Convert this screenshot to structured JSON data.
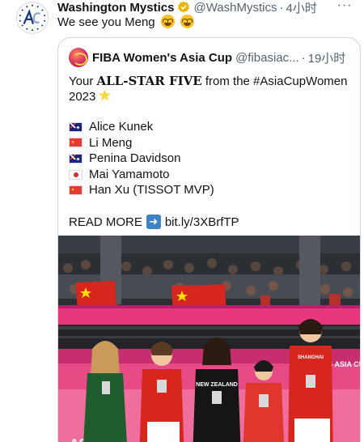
{
  "tweet": {
    "author_name": "Washington Mystics",
    "author_handle": "@WashMystics",
    "separator": "·",
    "time": "4小时",
    "text": "We see you Meng",
    "avatar_icon": "mystics-logo-icon",
    "verified_icon": "verified-badge-icon",
    "verified_color": "#e8b400"
  },
  "quote": {
    "author_name": "FIBA Women's Asia Cup",
    "author_handle": "@fibasiac...",
    "separator": "·",
    "time": "19小时",
    "line1_prefix": "Your ",
    "line1_emphasis": "ALL-STAR FIVE",
    "line1_suffix": " from the #AsiaCupWomen",
    "line2": "2023",
    "players": [
      {
        "flag": "AU",
        "name": "Alice Kunek"
      },
      {
        "flag": "CN",
        "name": "Li Meng"
      },
      {
        "flag": "NZ",
        "name": "Penina Davidson"
      },
      {
        "flag": "JP",
        "name": "Mai Yamamoto"
      },
      {
        "flag": "CN",
        "name": "Han Xu (TISSOT MVP)"
      }
    ],
    "read_more_label": "READ MORE",
    "read_more_link": "bit.ly/3XBrfTP",
    "photo_banner": "WOMEN'S ASIA CUP",
    "jersey_nz": "NEW ZEALAND",
    "jersey_cn": "SHANGHAI"
  },
  "colors": {
    "link": "#1d9bf0",
    "muted": "#536471",
    "text": "#0f1419",
    "china_red": "#d7261e",
    "board_pink": "#e8377c"
  }
}
